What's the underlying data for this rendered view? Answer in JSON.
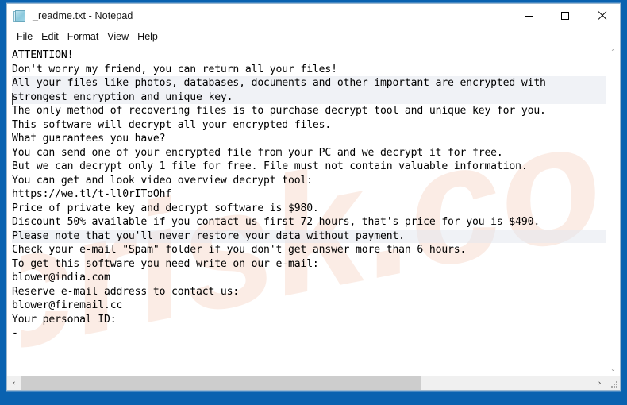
{
  "window": {
    "title": "_readme.txt - Notepad",
    "icon": "notepad-document-icon",
    "border_color": "#0a62b0",
    "controls": {
      "minimize_label": "Minimize",
      "maximize_label": "Maximize",
      "close_label": "Close"
    }
  },
  "menu": {
    "items": [
      {
        "label": "File"
      },
      {
        "label": "Edit"
      },
      {
        "label": "Format"
      },
      {
        "label": "View"
      },
      {
        "label": "Help"
      }
    ]
  },
  "document": {
    "lines": [
      "ATTENTION!",
      "Don't worry my friend, you can return all your files!",
      "All your files like photos, databases, documents and other important are encrypted with",
      "strongest encryption and unique key.",
      "The only method of recovering files is to purchase decrypt tool and unique key for you.",
      "This software will decrypt all your encrypted files.",
      "What guarantees you have?",
      "You can send one of your encrypted file from your PC and we decrypt it for free.",
      "But we can decrypt only 1 file for free. File must not contain valuable information.",
      "You can get and look video overview decrypt tool:",
      "https://we.tl/t-ll0rIToOhf",
      "Price of private key and decrypt software is $980.",
      "Discount 50% available if you contact us first 72 hours, that's price for you is $490.",
      "Please note that you'll never restore your data without payment.",
      "Check your e-mail \"Spam\" folder if you don't get answer more than 6 hours.",
      "To get this software you need write on our e-mail:",
      "blower@india.com",
      "Reserve e-mail address to contact us:",
      "blower@firemail.cc",
      "Your personal ID:",
      "-"
    ],
    "highlighted_line_indexes": [
      2,
      3,
      13
    ],
    "ransom_details": {
      "price_full": "$980",
      "price_discount": "$490",
      "discount_percent": "50%",
      "discount_window": "72 hours",
      "response_time": "6 hours",
      "video_url": "https://we.tl/t-ll0rIToOhf",
      "primary_email": "blower@india.com",
      "reserve_email": "blower@firemail.cc",
      "personal_id": "-"
    }
  },
  "watermark": {
    "text": "pcrisk.com",
    "color": "#fbeee8"
  },
  "scrollbars": {
    "vertical": {
      "up_glyph": "⌃",
      "down_glyph": "⌄"
    },
    "horizontal": {
      "left_glyph": "‹",
      "right_glyph": "›",
      "thumb_percent": 70
    }
  }
}
